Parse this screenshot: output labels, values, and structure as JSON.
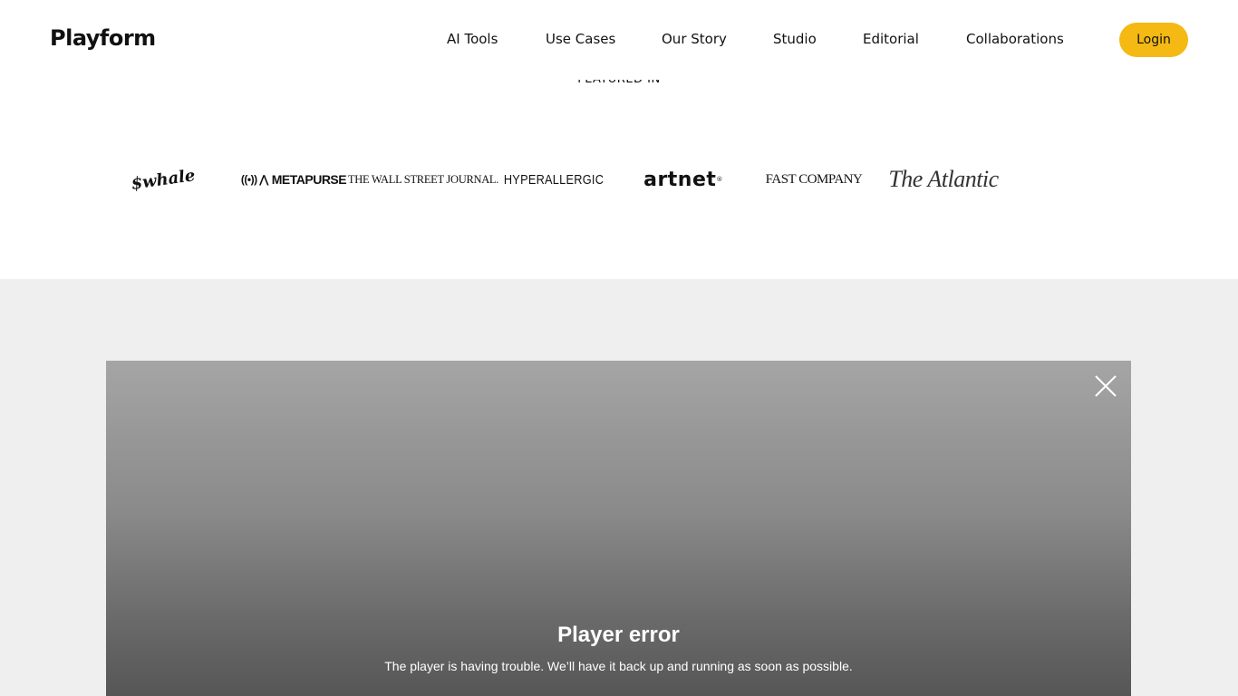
{
  "header": {
    "logo_text": "Playform",
    "nav": [
      {
        "label": "AI Tools"
      },
      {
        "label": "Use Cases"
      },
      {
        "label": "Our Story"
      },
      {
        "label": "Studio"
      },
      {
        "label": "Editorial"
      },
      {
        "label": "Collaborations"
      }
    ],
    "login_label": "Login",
    "accent_color": "#f5b914"
  },
  "featured": {
    "label": "FEATURED IN",
    "logos": [
      {
        "name": "whale-logo",
        "text": "$whale"
      },
      {
        "name": "metapurse-logo",
        "text": "METAPURSE"
      },
      {
        "name": "wsj-logo",
        "text": "THE WALL STREET JOURNAL."
      },
      {
        "name": "hyperallergic-logo",
        "text": "HYPERALLERGIC"
      },
      {
        "name": "artnet-logo",
        "text": "artnet"
      },
      {
        "name": "fastcompany-logo",
        "text": "FAST COMPANY"
      },
      {
        "name": "atlantic-logo",
        "text": "The Atlantic"
      }
    ]
  },
  "player": {
    "error_title": "Player error",
    "error_message": "The player is having trouble. We’ll have it back up and running as soon as possible.",
    "close_icon": "close-icon"
  }
}
